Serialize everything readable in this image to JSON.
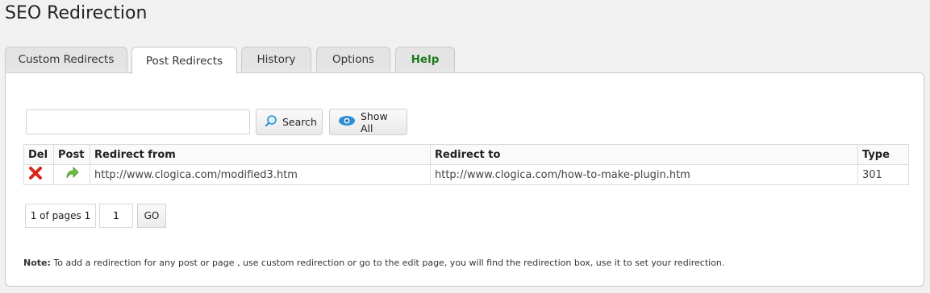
{
  "page": {
    "title": "SEO Redirection"
  },
  "tabs": [
    {
      "label": "Custom Redirects",
      "active": false
    },
    {
      "label": "Post Redirects",
      "active": true
    },
    {
      "label": "History",
      "active": false
    },
    {
      "label": "Options",
      "active": false
    },
    {
      "label": "Help",
      "active": false
    }
  ],
  "search": {
    "value": "",
    "button_label": "Search",
    "show_all_label": "Show All"
  },
  "table": {
    "headers": [
      "Del",
      "Post",
      "Redirect from",
      "Redirect to",
      "Type"
    ],
    "rows": [
      {
        "redirect_from": "http://www.clogica.com/modified3.htm",
        "redirect_to": "http://www.clogica.com/how-to-make-plugin.htm",
        "type": "301"
      }
    ]
  },
  "pagination": {
    "info": "1 of pages 1",
    "page_value": "1",
    "go_label": "GO"
  },
  "note": {
    "label": "Note:",
    "text": " To add a redirection for any post or page , use custom redirection or go to the edit page, you will find the redirection box, use it to set your redirection."
  },
  "colors": {
    "help_tab": "#1e7a1e",
    "delete_icon": "#d9261c",
    "post_icon": "#6bbf3a",
    "eye_icon": "#2a8fd6"
  }
}
